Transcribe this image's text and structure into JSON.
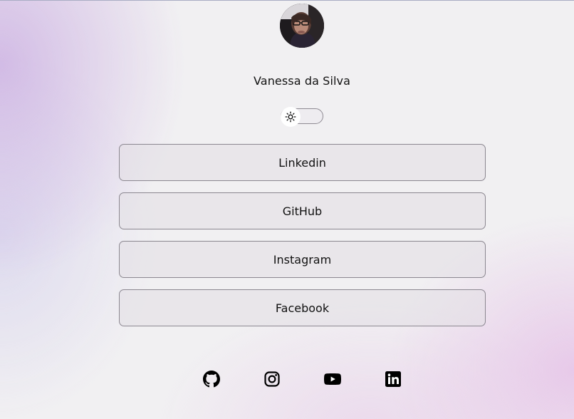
{
  "profile": {
    "name": "Vanessa da Silva"
  },
  "theme_toggle": {
    "icon": "sun-icon",
    "state": "light"
  },
  "links": [
    {
      "label": "Linkedin"
    },
    {
      "label": "GitHub"
    },
    {
      "label": "Instagram"
    },
    {
      "label": "Facebook"
    }
  ],
  "social_icons": [
    "github-icon",
    "instagram-icon",
    "youtube-icon",
    "linkedin-icon"
  ],
  "colors": {
    "text": "#111111",
    "button_border": "#8b8790"
  }
}
